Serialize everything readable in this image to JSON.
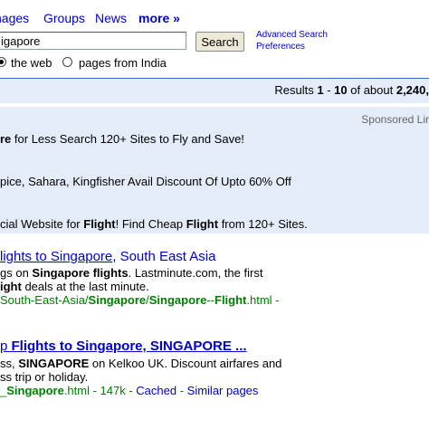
{
  "nav": {
    "images": "nages",
    "groups": "Groups",
    "news": "News",
    "more": "more »"
  },
  "search": {
    "query": "igapore",
    "button": "Search",
    "advanced_search": "Advanced Search",
    "preferences": "Preferences"
  },
  "scope": {
    "web_label": "the web",
    "india_label": "pages from India",
    "selected": "web"
  },
  "results_bar": {
    "prefix": "Results ",
    "start": "1",
    "sep": " - ",
    "end": "10",
    "middle": " of about ",
    "total": "2,240,"
  },
  "sponsored": {
    "label": "Sponsored Lir",
    "ad1": {
      "bold": "re",
      "rest": " for Less Search 120+ Sites to Fly and Save!"
    },
    "ad2": {
      "text": "pice, Sahara, Kingfisher Avail Discount Of Upto 60% Off"
    },
    "ad3": {
      "t1": "cial Website for ",
      "b1": "Flight",
      "t2": "! Find Cheap ",
      "b2": "Flight",
      "t3": " from 120+ Sites."
    }
  },
  "results": [
    {
      "title_link": "lights to Singapore",
      "title_rest": ", South East Asia",
      "line1_a": "gs on ",
      "line1_b": "Singapore flights",
      "line1_c": ". Lastminute.com, the first",
      "line2_a": "ight",
      "line2_b": " deals at the last minute.",
      "url_a": "South-East-Asia/",
      "url_b": "Singapore",
      "url_c": "/",
      "url_d": "Singapore",
      "url_e": "--",
      "url_f": "Flight",
      "url_g": ".html -"
    },
    {
      "title_a": "p ",
      "title_b": "Flights to Singapore, SINGAPORE ...",
      "line1_a": "ss, ",
      "line1_b": "SINGAPORE",
      "line1_c": " on Kelkoo UK. Discount airfares and",
      "line2": "ss trip or holiday.",
      "url_a": "_",
      "url_b": "Singapore",
      "url_c": ".html - 147k - ",
      "cached": "Cached",
      "dash": " - ",
      "similar": "Similar pages"
    }
  ]
}
